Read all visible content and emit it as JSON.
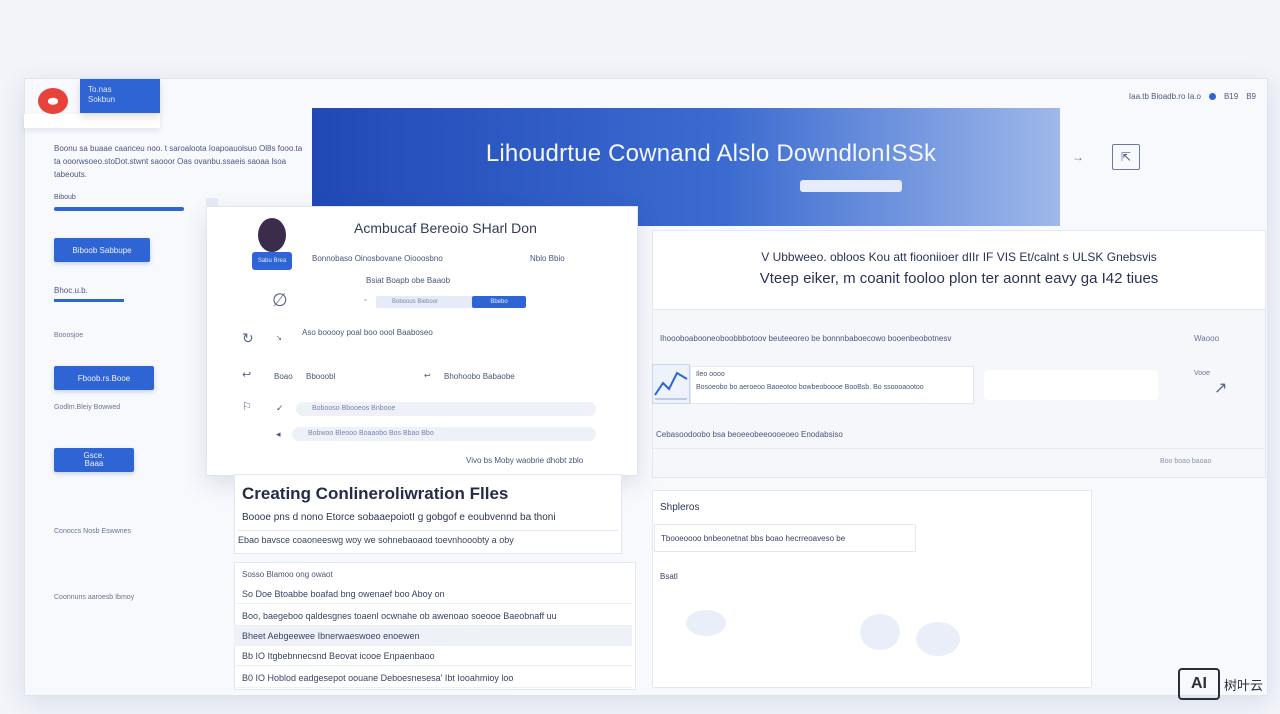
{
  "app": {
    "logo_text": "⬬",
    "chip_line1": "To.nas",
    "chip_line2": "Sokbun"
  },
  "topbar": {
    "right_text": "Iaa.tb Bioadb.ro Ia.o",
    "right_b": "B19",
    "right_c": "B9"
  },
  "sidebar": {
    "description": "Boonu sa buaae caanceu noo. t saroaloota Ioapoauolsuo Ol8s fooo.ta ta ooorwsoeo.stoDot.stwnt saooor Oas ovanbu.ssaeis saoaa lsoa tabeouts.",
    "underline_label": "Biboub",
    "button1": "Biboob Sabbupe",
    "link_label": "Bhoc.u.b.",
    "text1": "Booosjoe",
    "button2": "Fboob.rs.Booe",
    "text2": "Godlm.Bleiy Bowwed",
    "button3": "Gsce.\nBaaa",
    "text3": "Conoccs Nosb Eswwnes",
    "text4": "Coonnuns aaroesb Ibmoy"
  },
  "hero": {
    "title": "Lihoudrtue Cownand Alslo DowndlonISSk",
    "arrow": "→",
    "ext_icon": "⇱"
  },
  "modal": {
    "title": "Acmbucaf Bereoio SHarl Don",
    "avatar_tag": "Sabu Brea",
    "line1": "Bonnobaso Oinosbovane Oiooosbno",
    "line1_right": "Nblo Bbio",
    "line2": "Bsiat  Boapb obe Baaob",
    "input_placeholder": "Bobooos Bieboor",
    "input_button": "Bbebo",
    "row1": "Aso booooy poal boo oool Baaboseo",
    "row2_a": "Boao",
    "row2_b": "Bbooobl",
    "row2_c": "Bhohoobo Babaobe",
    "field1": "Bobooso Bbooeos Bnbooe",
    "field2": "Bobwoo Bleooo Boaaobo Bos Bbao Bbo",
    "footer": "Vivo bs Moby  waobrie dhobt zblo"
  },
  "config": {
    "title": "Creating Conlineroliwration Flles",
    "line1": "Boooe pns d nono Etorce sobaaepoiotI g gobgof e eoubvennd ba thoni",
    "line2": "Ebao bavsce  coaoneeswg woy we sohnebaoaod toevnhooobty a oby"
  },
  "list": {
    "header": "Sosso Blamoo ong owaot",
    "rows": [
      "So  Doe Btoabbe boafad bng owenaef boo Aboy on",
      "Boo, baegeboo qaldesgnes toaenl ocwnahe ob awenoao soeooe Baeobnaff uu",
      "Bheet  Aebgeewee Ibnerwaeswoeo enoewen",
      "Bb  IO   Itgbebnnecsnd Beovat icooe Enpaenbaoo",
      "B0  IO  Hoblod eadgesepot oouane Deboesnesesa' Ibt Iooahmioy loo"
    ]
  },
  "right_panel": {
    "line1": "V  Ubbweeo. obloos  Kou att fiooniioer dIIr IF VIS Et/calnt s ULSK Gnebsvis",
    "line2": "Vteep eiker, m coanit fooloo plon ter aonnt eavy ga I42 tiues",
    "row1": "Ihoooboabooneoboobbbotoov beuteeoreo be bonnnbaboecowo booenbeobotnesv",
    "row1_right": "Waooo",
    "box_t1": "Ileo oooo",
    "box_t2": "Bosoeobo bo aeroeoo Baoeotoo bowbeoboooe BooBsb. Bo ssoooaootoo",
    "side_r": "Vooe",
    "row3": "Cebasoodoobo bsa beoeeobeeoooeoeo Enodabsiso",
    "row4": "Boo boao baoao"
  },
  "samples": {
    "title": "Shpleros",
    "chip": "Tbooeoooo bnbeonetnat bbs boao hecrreoaveso be",
    "label": "Bsatl"
  },
  "watermark": {
    "box": "AI",
    "text": "树叶云"
  }
}
